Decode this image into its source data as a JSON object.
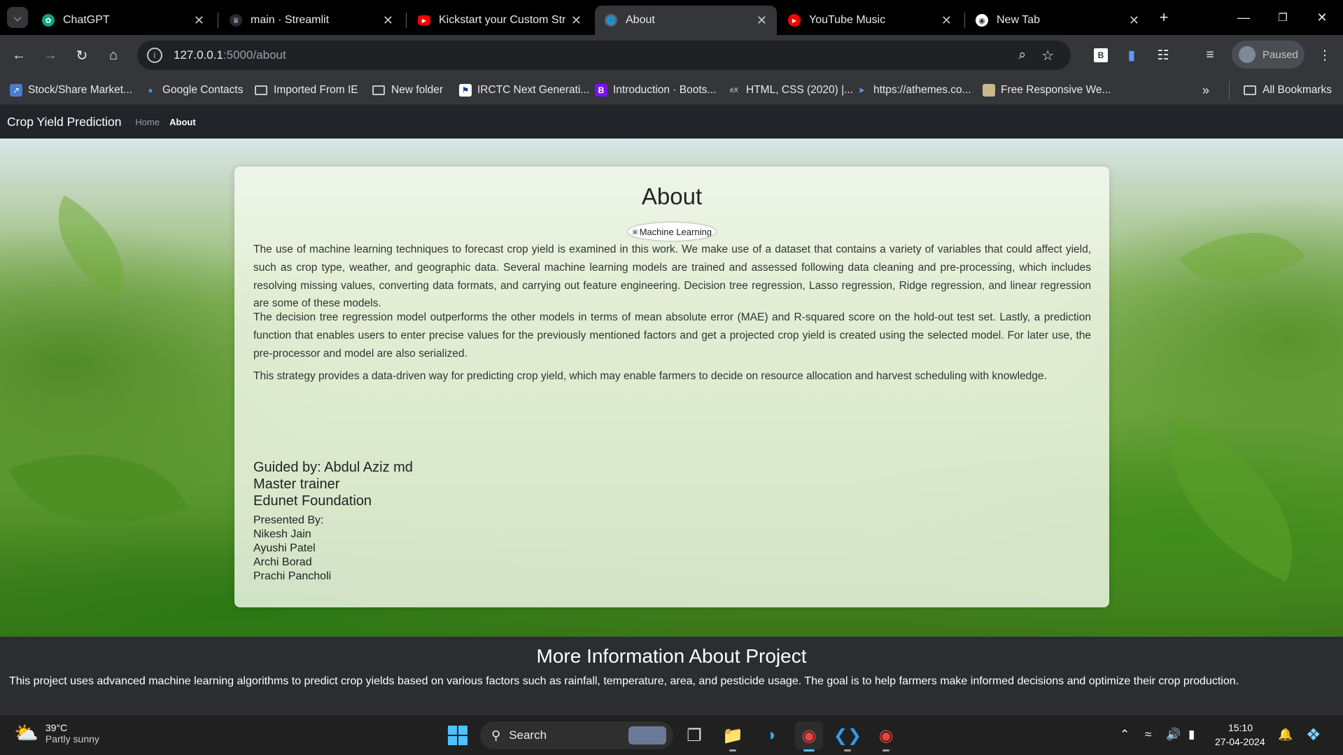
{
  "browser": {
    "tabs": [
      {
        "title": "ChatGPT",
        "icon": "chatgpt-icon",
        "active": false
      },
      {
        "title": "main · Streamlit",
        "icon": "streamlit-icon",
        "active": false
      },
      {
        "title": "Kickstart your Custom Stre",
        "icon": "youtube-icon",
        "active": false
      },
      {
        "title": "About",
        "icon": "globe-icon",
        "active": true
      },
      {
        "title": "YouTube Music",
        "icon": "youtube-music-icon",
        "active": false
      },
      {
        "title": "New Tab",
        "icon": "chrome-icon",
        "active": false
      }
    ],
    "url_host": "127.0.0.1",
    "url_path": ":5000/about",
    "profile_label": "Paused",
    "bookmarks": [
      "Stock/Share Market...",
      "Google Contacts",
      "Imported From IE",
      "New folder",
      "IRCTC Next Generati...",
      "Introduction · Boots...",
      "HTML, CSS (2020) |...",
      "https://athemes.co...",
      "Free Responsive We..."
    ],
    "all_bookmarks_label": "All Bookmarks"
  },
  "site": {
    "brand": "Crop Yield Prediction",
    "nav": {
      "home": "Home",
      "about": "About"
    },
    "about_title": "About",
    "image_alt": "Machine Learning",
    "paragraphs": [
      "The use of machine learning techniques to forecast crop yield is examined in this work. We make use of a dataset that contains a variety of variables that could affect yield, such as crop type, weather, and geographic data. Several machine learning models are trained and assessed following data cleaning and pre-processing, which includes resolving missing values, converting data formats, and carrying out feature engineering. Decision tree regression, Lasso regression, Ridge regression, and linear regression are some of these models.",
      "The decision tree regression model outperforms the other models in terms of mean absolute error (MAE) and R-squared score on the hold-out test set. Lastly, a prediction function that enables users to enter precise values for the previously mentioned factors and get a projected crop yield is created using the selected model. For later use, the pre-processor and model are also serialized.",
      "This strategy provides a data-driven way for predicting crop yield, which may enable farmers to decide on resource allocation and harvest scheduling with knowledge."
    ],
    "guide_lines": [
      "Guided by: Abdul Aziz md",
      "Master trainer",
      "Edunet Foundation"
    ],
    "presented_label": "Presented By:",
    "presenters": [
      "Nikesh Jain",
      "Ayushi Patel",
      "Archi Borad",
      "Prachi Pancholi"
    ],
    "more_title": "More Information About Project",
    "more_text": "This project uses advanced machine learning algorithms to predict crop yields based on various factors such as rainfall, temperature, area, and pesticide usage. The goal is to help farmers make informed decisions and optimize their crop production."
  },
  "taskbar": {
    "weather_temp": "39°C",
    "weather_desc": "Partly sunny",
    "search_placeholder": "Search",
    "time": "15:10",
    "date": "27-04-2024"
  }
}
